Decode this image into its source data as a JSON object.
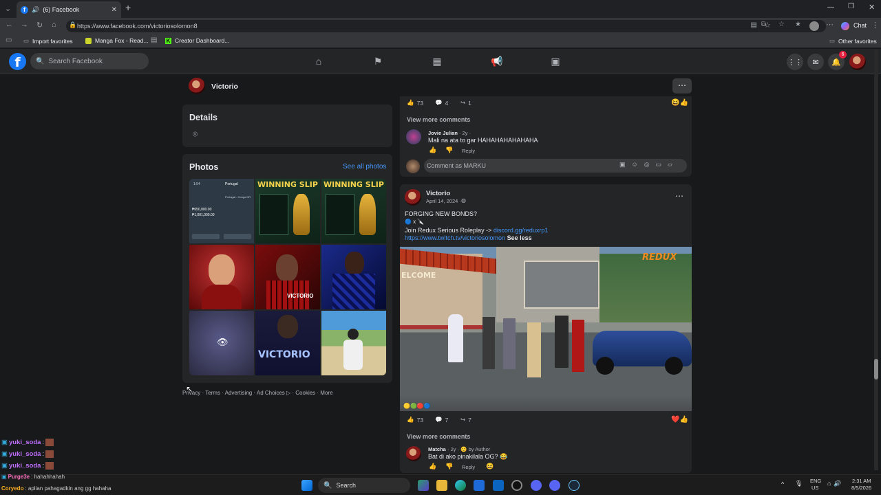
{
  "browser": {
    "tab_title": "(6) Facebook",
    "url": "https://www.facebook.com/victoriosolomon8",
    "chat_label": "Chat",
    "favorites": [
      "Import favorites",
      "Manga Fox - Read...",
      "Creator Dashboard..."
    ],
    "other_favorites": "Other favorites"
  },
  "fb": {
    "search_placeholder": "Search Facebook",
    "notification_count": "6",
    "profile_name": "Victorio"
  },
  "left": {
    "details_title": "Details",
    "photos_title": "Photos",
    "see_all": "See all photos",
    "photo_texts": {
      "p1_title": "Portugal",
      "p1_sub": "Portugal - Congo DR",
      "p1_a": "₱650,000.00",
      "p1_b": "₱1,001,000.00",
      "p2": "WINNING SLIP",
      "p3": "WINNING SLIP",
      "p5": "VICTORIO",
      "p8": "VICTORIO"
    },
    "footer": "Privacy · Terms · Advertising · Ad Choices ▷ · Cookies · More"
  },
  "post1": {
    "likes": "73",
    "comments": "4",
    "shares": "1",
    "view_more": "View more comments",
    "commenter": "Jovie Julian",
    "comment_time": "· 2y ·",
    "comment_text": "Mali na ata to gar HAHAHAHAHAHAHA",
    "reply": "Reply",
    "comment_as": "Comment as MARKU"
  },
  "post2": {
    "author": "Victorio",
    "date": "April 14, 2024 ·",
    "line1": "FORGING NEW BONDS?",
    "line3_prefix": "Join Redux Serious Roleplay -> ",
    "line3_link": "discord.gg/reduxrp1",
    "line4_link": "https://www.twitch.tv/victoriosolomon",
    "see_less": "See less",
    "image_sign": "ELCOME",
    "image_logo": "REDUX",
    "likes": "73",
    "comments": "7",
    "shares": "7",
    "view_more": "View more comments",
    "commenter": "Matcha",
    "comment_meta": "· 2y · 😊 by Author",
    "comment_text": "Bat di ako pinakilala OG? 😂",
    "reply": "Reply"
  },
  "overlay_chat": [
    {
      "user": "yuki_soda",
      "msg": ":"
    },
    {
      "user": "yuki_soda",
      "msg": ":"
    },
    {
      "user": "yuki_soda",
      "msg": ":"
    },
    {
      "user": "Purge3e",
      "msg": ": hahahhahah"
    },
    {
      "user": "Coryedo",
      "msg": ": aplian pahagadkin ang gg hahaha"
    }
  ],
  "taskbar": {
    "search": "Search",
    "lang1": "ENG",
    "lang2": "US",
    "time": "2:31 AM",
    "date": "8/5/2026"
  },
  "colors": {
    "fb_blue": "#1877f2",
    "link": "#4599ff",
    "card": "#242526",
    "bg": "#18191a"
  }
}
